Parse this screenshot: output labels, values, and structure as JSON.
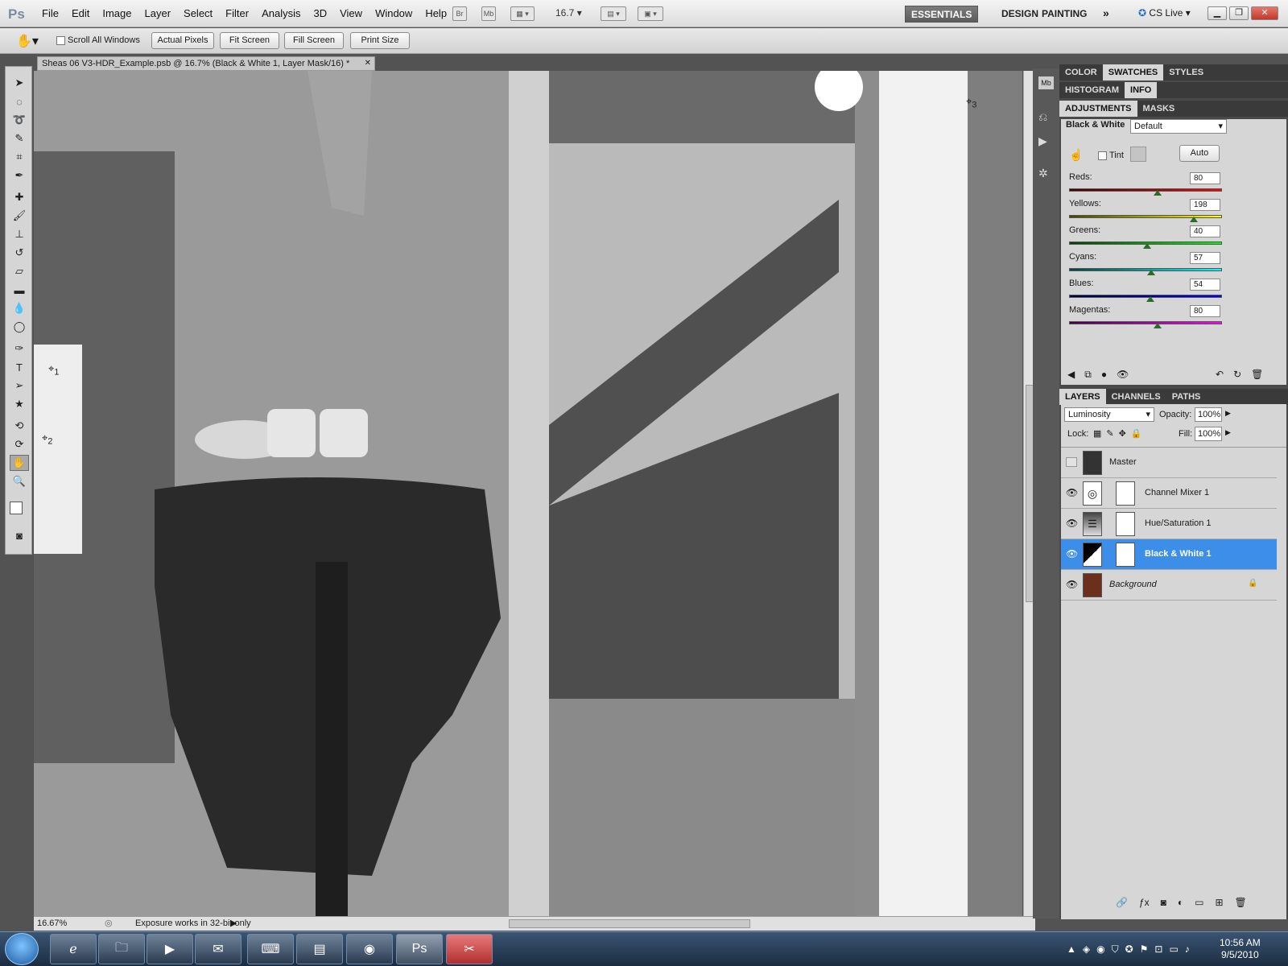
{
  "app": {
    "logo": "Ps"
  },
  "menu": [
    "File",
    "Edit",
    "Image",
    "Layer",
    "Select",
    "Filter",
    "Analysis",
    "3D",
    "View",
    "Window",
    "Help"
  ],
  "toolbar": {
    "bridge": "Br",
    "minibridge": "Mb",
    "zoom": "16.7"
  },
  "workspaces": [
    "ESSENTIALS",
    "DESIGN",
    "PAINTING"
  ],
  "cslive": "CS Live",
  "options": {
    "scroll_all_windows": "Scroll All Windows",
    "actual_pixels": "Actual Pixels",
    "fit_screen": "Fit Screen",
    "fill_screen": "Fill Screen",
    "print_size": "Print Size"
  },
  "document": {
    "tab_title": "Sheas 06 V3-HDR_Example.psb @ 16.7% (Black & White 1, Layer Mask/16) *",
    "zoom_status": "16.67%",
    "status_text": "Exposure works in 32-bit only",
    "sample_markers": [
      "1",
      "2",
      "3"
    ]
  },
  "panel_tabs": {
    "row1": [
      "COLOR",
      "SWATCHES",
      "STYLES"
    ],
    "row2": [
      "HISTOGRAM",
      "INFO"
    ],
    "row3": [
      "ADJUSTMENTS",
      "MASKS"
    ],
    "layers_tabs": [
      "LAYERS",
      "CHANNELS",
      "PATHS"
    ]
  },
  "adjustments": {
    "title": "Black & White",
    "preset": "Default",
    "tint_label": "Tint",
    "auto_label": "Auto",
    "sliders": [
      {
        "label": "Reds:",
        "value": "80"
      },
      {
        "label": "Yellows:",
        "value": "198"
      },
      {
        "label": "Greens:",
        "value": "40"
      },
      {
        "label": "Cyans:",
        "value": "57"
      },
      {
        "label": "Blues:",
        "value": "54"
      },
      {
        "label": "Magentas:",
        "value": "80"
      }
    ]
  },
  "layers": {
    "blend_mode": "Luminosity",
    "opacity_label": "Opacity:",
    "opacity": "100%",
    "lock_label": "Lock:",
    "fill_label": "Fill:",
    "fill": "100%",
    "items": [
      {
        "name": "Master"
      },
      {
        "name": "Channel Mixer 1"
      },
      {
        "name": "Hue/Saturation 1"
      },
      {
        "name": "Black & White 1"
      },
      {
        "name": "Background"
      }
    ]
  },
  "clock": {
    "time": "10:56 AM",
    "date": "9/5/2010"
  },
  "colors": {
    "selection": "#3d8ee8",
    "panel": "#d6d6d6",
    "workspace_bg": "#535353"
  }
}
